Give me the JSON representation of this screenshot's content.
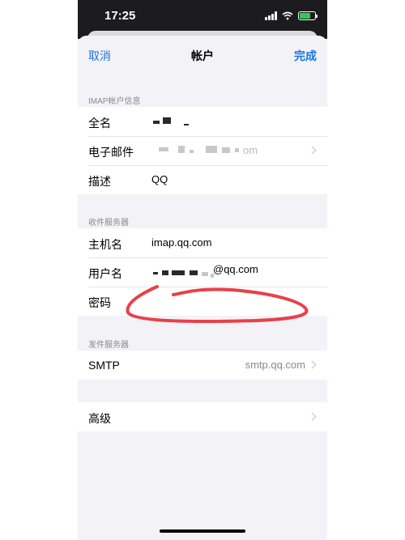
{
  "status_bar": {
    "time": "17:25",
    "icons": [
      "signal-icon",
      "wifi-icon",
      "battery-charging-icon"
    ]
  },
  "nav": {
    "cancel": "取消",
    "title": "帐户",
    "done": "完成",
    "accent_color": "#1a73e8"
  },
  "imap_section": {
    "header": "IMAP帐户信息",
    "name_label": "全名",
    "email_label": "电子邮件",
    "email_value_suffix": "om",
    "description_label": "描述",
    "description_value": "QQ"
  },
  "incoming_section": {
    "header": "收件服务器",
    "hostname_label": "主机名",
    "hostname_value": "imap.qq.com",
    "username_label": "用户名",
    "username_value_suffix": "@qq.com",
    "password_label": "密码"
  },
  "outgoing_section": {
    "header": "发件服务器",
    "smtp_label": "SMTP",
    "smtp_value": "smtp.qq.com"
  },
  "advanced_section": {
    "label": "高级"
  },
  "annotation_color": "#e8404a"
}
